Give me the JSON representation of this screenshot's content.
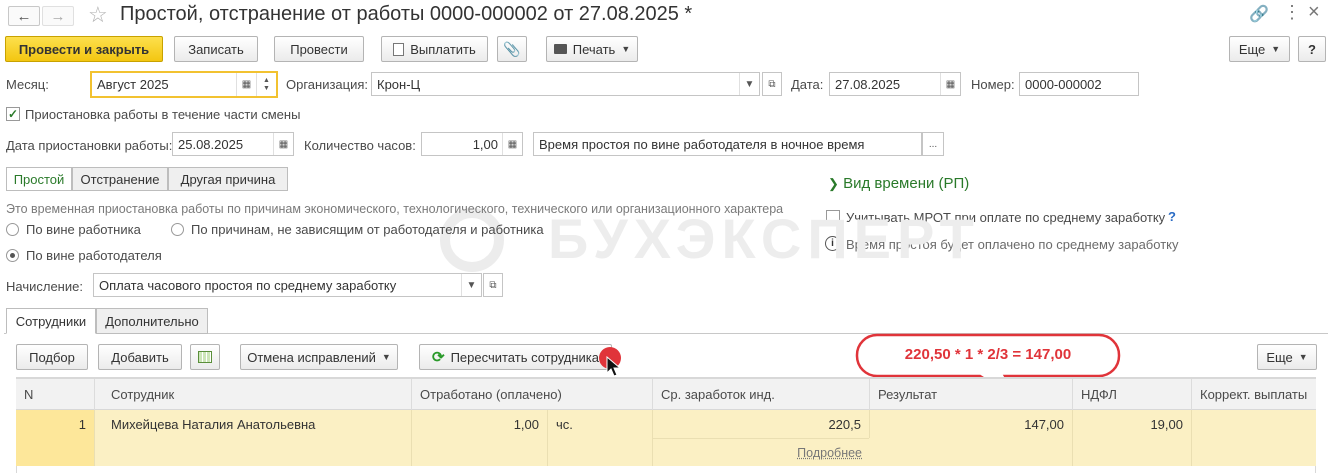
{
  "window": {
    "title": "Простой, отстранение от работы 0000-000002 от 27.08.2025 *"
  },
  "toolbar": {
    "post_close": "Провести и закрыть",
    "save": "Записать",
    "post": "Провести",
    "pay": "Выплатить",
    "print": "Печать",
    "more": "Еще",
    "help": "?"
  },
  "header": {
    "month_label": "Месяц:",
    "month_value": "Август 2025",
    "org_label": "Организация:",
    "org_value": "Крон-Ц",
    "date_label": "Дата:",
    "date_value": "27.08.2025",
    "number_label": "Номер:",
    "number_value": "0000-000002"
  },
  "partial_shift": {
    "label": "Приостановка работы в течение части смены",
    "checked": true
  },
  "suspension": {
    "date_label": "Дата приостановки работы:",
    "date_value": "25.08.2025",
    "hours_label": "Количество часов:",
    "hours_value": "1,00",
    "time_type_value": "Время простоя по вине работодателя в ночное время",
    "select_btn": "..."
  },
  "type_tabs": [
    "Простой",
    "Отстранение",
    "Другая причина"
  ],
  "description": "Это временная приостановка работы по причинам экономического, технологического, технического или организационного характера",
  "radios": {
    "employee": "По вине работника",
    "independent": "По причинам, не зависящим от работодателя и работника",
    "employer": "По вине работодателя",
    "selected": "employer"
  },
  "right_panel": {
    "time_kind_link": "Вид времени (РП)",
    "mrot_label": "Учитывать МРОТ при оплате по среднему заработку",
    "mrot_help": "?",
    "info_text": "Время простоя будет оплачено по среднему заработку"
  },
  "accrual": {
    "label": "Начисление:",
    "value": "Оплата часового простоя по среднему заработку"
  },
  "bottom_tabs": [
    "Сотрудники",
    "Дополнительно"
  ],
  "table_toolbar": {
    "pick": "Подбор",
    "add": "Добавить",
    "cancel_corrections": "Отмена исправлений",
    "recalc": "Пересчитать сотрудника",
    "more": "Еще"
  },
  "callout": "220,50 * 1 * 2/3 = 147,00",
  "watermark": "БУХЭКСПЕРТ",
  "table": {
    "columns": [
      "N",
      "Сотрудник",
      "Отработано (оплачено)",
      "Ср. заработок инд.",
      "Результат",
      "НДФЛ",
      "Коррект. выплаты"
    ],
    "rows": [
      {
        "n": "1",
        "employee": "Михейцева Наталия Анатольевна",
        "worked": "1,00",
        "unit": "чс.",
        "avg_earnings": "220,5",
        "details_link": "Подробнее",
        "result": "147,00",
        "ndfl": "19,00",
        "correction": ""
      }
    ]
  },
  "colors": {
    "primary_button": "#f3c611",
    "link_green": "#2a7a2a",
    "row_highlight": "#fbf0c4",
    "callout_border": "#e0343a",
    "callout_text": "#e0343a"
  }
}
